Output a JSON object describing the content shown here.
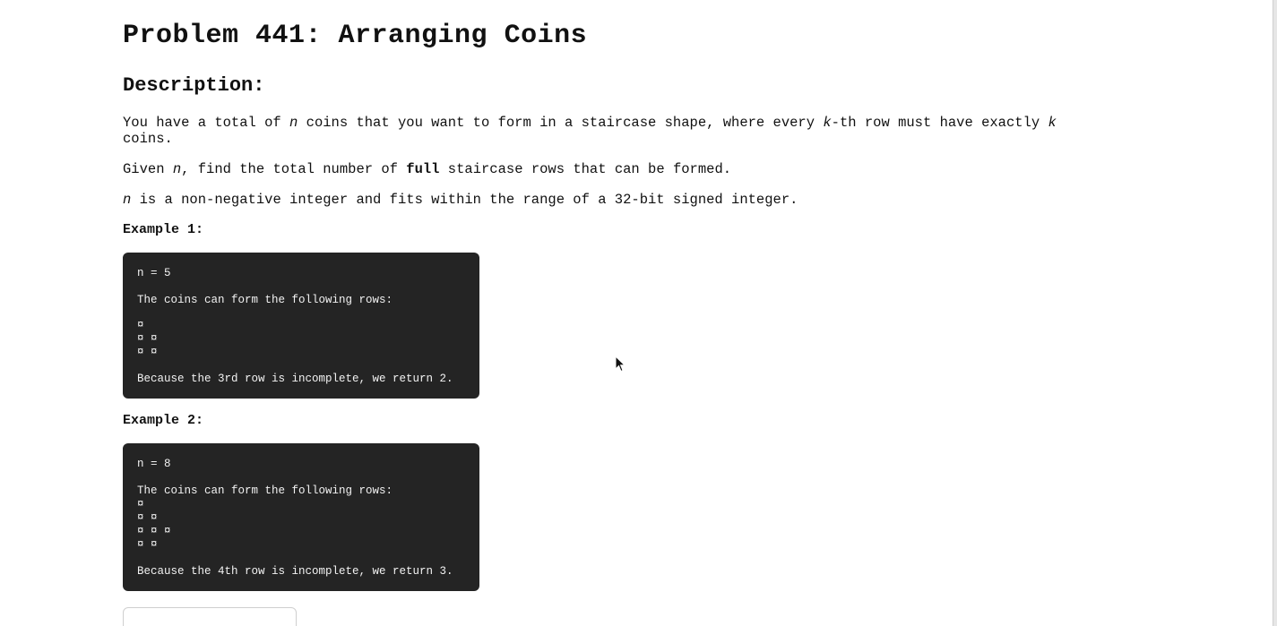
{
  "title": "Problem 441: Arranging Coins",
  "description_heading": "Description:",
  "description": {
    "p1": {
      "t1": "You have a total of ",
      "n": "n",
      "t2": " coins that you want to form in a staircase shape, where every ",
      "k1": "k",
      "t3": "-th row must have exactly ",
      "k2": "k",
      "t4": " coins."
    },
    "p2": {
      "t1": "Given ",
      "n": "n",
      "t2": ", find the total number of ",
      "bold": "full",
      "t3": " staircase rows that can be formed."
    },
    "p3": {
      "n": "n",
      "t1": " is a non-negative integer and fits within the range of a 32-bit signed integer."
    }
  },
  "examples": [
    {
      "label": "Example 1:",
      "input": "n = 5",
      "intro": "The coins can form the following rows:",
      "rows": [
        "¤",
        "¤ ¤",
        "¤ ¤"
      ],
      "result": "Because the 3rd row is incomplete, we return 2."
    },
    {
      "label": "Example 2:",
      "input": "n = 8",
      "intro": "The coins can form the following rows:",
      "rows": [
        "¤",
        "¤ ¤",
        "¤ ¤ ¤",
        "¤ ¤"
      ],
      "result": "Because the 4th row is incomplete, we return 3."
    }
  ],
  "colors": {
    "code_background": "#242424",
    "code_text": "#f2f2f2",
    "page_background": "#ffffff"
  }
}
